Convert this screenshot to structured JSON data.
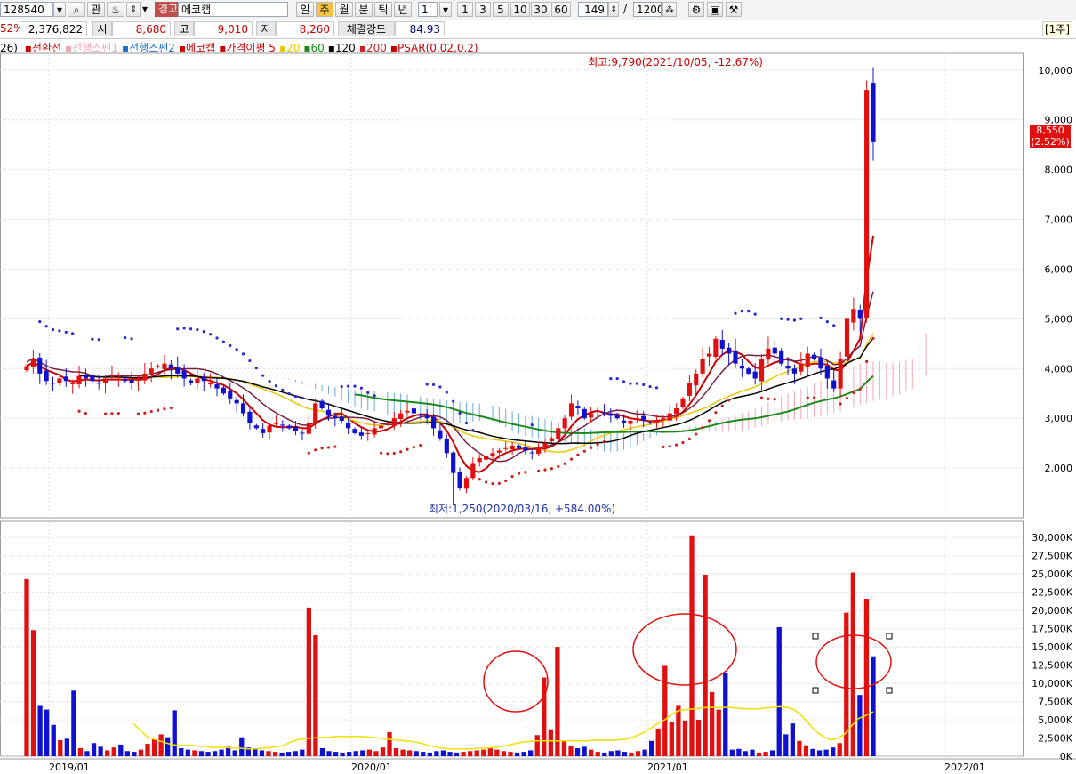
{
  "toolbar": {
    "code": "128540",
    "btn_gwan": "관",
    "badge": "경고",
    "name": "에코캡",
    "periods": [
      "일",
      "주",
      "월",
      "분",
      "틱",
      "년"
    ],
    "count_value": "1",
    "quick_counts": [
      "1",
      "3",
      "5",
      "10",
      "30",
      "60"
    ],
    "bars_shown": "149",
    "slash": "/",
    "bars_total": "1200"
  },
  "infobar": {
    "change_pct": "52%",
    "volume": "2,376,822",
    "open_label": "시",
    "open": "8,680",
    "high_label": "고",
    "high": "9,010",
    "low_label": "저",
    "low": "8,260",
    "strength_label": "체결강도",
    "strength": "84.93",
    "period_tag": "[1주]"
  },
  "legend": {
    "prefix": "26)",
    "items": [
      {
        "name": "전환선",
        "color": "#cc0000"
      },
      {
        "name": "선행스팬1",
        "color": "#f4a6b4"
      },
      {
        "name": "선행스팬2",
        "color": "#1f6fc8"
      },
      {
        "name": "에코캡",
        "color": "#cc0000"
      },
      {
        "name": "가격이평 5",
        "color": "#cc0000"
      },
      {
        "name": "20",
        "color": "#e8c800"
      },
      {
        "name": "60",
        "color": "#1a8a1a"
      },
      {
        "name": "120",
        "color": "#000000"
      },
      {
        "name": "200",
        "color": "#cc2222"
      },
      {
        "name": "PSAR(0.02,0.2)",
        "color": "#cc0000"
      }
    ]
  },
  "annotations": {
    "high": "최고:9,790(2021/10/05, -12.67%)",
    "low": "최저:1,250(2020/03/16, +584.00%)"
  },
  "price_badge": {
    "price": "8,550",
    "change": "(2.52%)"
  },
  "chart_data": [
    {
      "type": "candlestick",
      "name": "에코캡 주봉",
      "x_labels": [
        "2019/01",
        "2020/01",
        "2021/01",
        "2022/01"
      ],
      "y_ticks": [
        "2,000",
        "3,000",
        "4,000",
        "5,000",
        "6,000",
        "7,000",
        "8,000",
        "9,000",
        "10,000"
      ],
      "ylim": [
        1000,
        10300
      ],
      "grid": true,
      "high": 9790,
      "low": 1250,
      "last": 8550,
      "close_series": [
        4050,
        4200,
        3900,
        3750,
        3700,
        3800,
        3750,
        3700,
        3850,
        3800,
        3750,
        3700,
        3800,
        3850,
        3800,
        3750,
        3700,
        3800,
        3900,
        4000,
        4050,
        4100,
        4000,
        3900,
        3800,
        3700,
        3800,
        3750,
        3700,
        3600,
        3500,
        3400,
        3300,
        3100,
        2900,
        2800,
        2700,
        2850,
        2900,
        2850,
        2800,
        2750,
        2700,
        2900,
        3300,
        3200,
        3050,
        3000,
        2950,
        2800,
        2700,
        2650,
        2700,
        2800,
        2850,
        2900,
        3000,
        3100,
        3150,
        3100,
        3050,
        3000,
        2800,
        2600,
        2300,
        1900,
        1600,
        1800,
        2100,
        2200,
        2250,
        2300,
        2350,
        2400,
        2450,
        2400,
        2350,
        2300,
        2400,
        2500,
        2600,
        2800,
        3000,
        3300,
        3200,
        3000,
        3100,
        3150,
        3100,
        3050,
        3000,
        2900,
        2950,
        3000,
        2950,
        2900,
        2950,
        3000,
        3100,
        3200,
        3400,
        3700,
        3900,
        4200,
        4300,
        4600,
        4400,
        4300,
        4100,
        4000,
        3900,
        3800,
        4200,
        4400,
        4300,
        4100,
        4000,
        3900,
        4100,
        4300,
        4200,
        4000,
        3800,
        3600,
        4200,
        5000,
        5200,
        5000,
        9600,
        8550
      ]
    },
    {
      "type": "bar",
      "name": "거래량",
      "y_ticks": [
        "0K",
        "2,500K",
        "5,000K",
        "7,500K",
        "10,000K",
        "12,500K",
        "15,000K",
        "17,500K",
        "20,000K",
        "22,500K",
        "25,000K",
        "27,500K",
        "30,000K"
      ],
      "ylim_k": [
        0,
        31000
      ],
      "values_k": [
        24300,
        17300,
        6900,
        6400,
        4300,
        2200,
        2400,
        9000,
        1100,
        700,
        1800,
        1300,
        800,
        1200,
        1600,
        700,
        600,
        900,
        1700,
        2300,
        3000,
        2600,
        6300,
        1100,
        900,
        800,
        700,
        600,
        700,
        900,
        1300,
        800,
        2600,
        1200,
        1000,
        800,
        700,
        600,
        500,
        600,
        700,
        900,
        20400,
        16600,
        1100,
        700,
        600,
        500,
        600,
        700,
        800,
        900,
        700,
        1200,
        3300,
        1100,
        900,
        800,
        700,
        600,
        500,
        700,
        800,
        600,
        500,
        600,
        700,
        800,
        900,
        1100,
        900,
        700,
        600,
        500,
        600,
        800,
        2900,
        10800,
        3700,
        15000,
        2200,
        1400,
        1100,
        1300,
        900,
        600,
        500,
        700,
        800,
        600,
        500,
        700,
        900,
        2100,
        3800,
        12400,
        4700,
        6900,
        4900,
        30300,
        5000,
        24900,
        8800,
        6400,
        11400,
        900,
        1000,
        700,
        900,
        500,
        600,
        800,
        17700,
        3000,
        4500,
        2100,
        1500,
        1000,
        800,
        900,
        1200,
        1800,
        19700,
        25200,
        8400,
        21600,
        13700
      ],
      "ma_values_k": [
        4500,
        3500,
        2600,
        2300,
        2000,
        1700,
        1500,
        1500,
        1500,
        1400,
        1300,
        1200,
        1200,
        1200,
        1100,
        1100,
        1000,
        1000,
        1100,
        1200,
        1300,
        1500,
        2000,
        2300,
        2400,
        2500,
        2600,
        2600,
        2700,
        2700,
        2700,
        2700,
        2700,
        2600,
        2500,
        2400,
        2300,
        2200,
        2100,
        2000,
        1800,
        1500,
        1300,
        1100,
        1000,
        1000,
        1000,
        1000,
        1100,
        1100,
        1200,
        1300,
        1500,
        1700,
        1900,
        2000,
        2100,
        2100,
        2100,
        2100,
        2100,
        2100,
        2100,
        2100,
        2200,
        2200,
        2200,
        2200,
        2300,
        2400,
        2800,
        3200,
        3800,
        4500,
        5000,
        5800,
        6300,
        6400,
        6500,
        6600,
        6700,
        6700,
        6700,
        6700,
        6600,
        6500,
        6500,
        6500,
        6600,
        6700,
        6800,
        6700,
        6400,
        5600,
        4500,
        3400,
        2700,
        2300,
        2400,
        3000,
        4200,
        5200,
        5600,
        6100
      ]
    }
  ]
}
